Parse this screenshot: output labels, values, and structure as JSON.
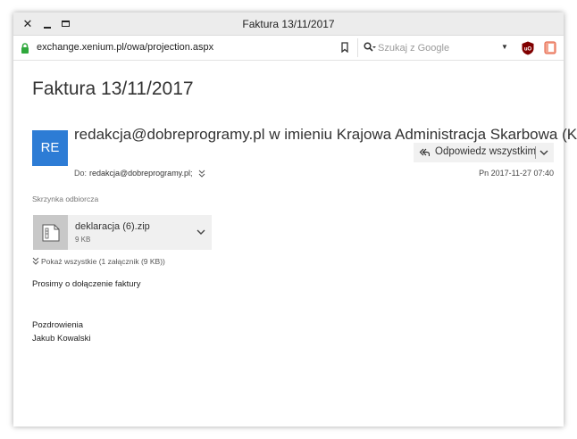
{
  "window": {
    "title": "Faktura 13/11/2017",
    "close_label": "✕"
  },
  "browser": {
    "url": "exchange.xenium.pl/owa/projection.aspx",
    "search_placeholder": "Szukaj z Google",
    "icons": [
      "lock-icon",
      "bookmark-icon",
      "search-icon",
      "ublock-icon",
      "extension-icon"
    ],
    "ublock_color": "#800000",
    "extension_color": "#e8735a"
  },
  "email": {
    "subject": "Faktura 13/11/2017",
    "avatar_initials": "RE",
    "avatar_color": "#2d7cd5",
    "sender": "redakcja@dobreprogramy.pl w imieniu Krajowa Administracja Skarbowa (KAS)",
    "reply_all_label": "Odpowiedz wszystkim",
    "to_label": "Do:",
    "to_value": "redakcja@dobreprogramy.pl;",
    "date": "Pn 2017-11-27 07:40",
    "folder": "Skrzynka odbiorcza",
    "attachment": {
      "name": "deklaracja (6).zip",
      "size": "9 KB"
    },
    "show_all": "Pokaż wszystkie (1 załącznik (9 KB))",
    "body_lines": [
      "Prosimy o dołączenie faktury",
      "Pozdrowienia",
      "Jakub Kowalski"
    ]
  }
}
